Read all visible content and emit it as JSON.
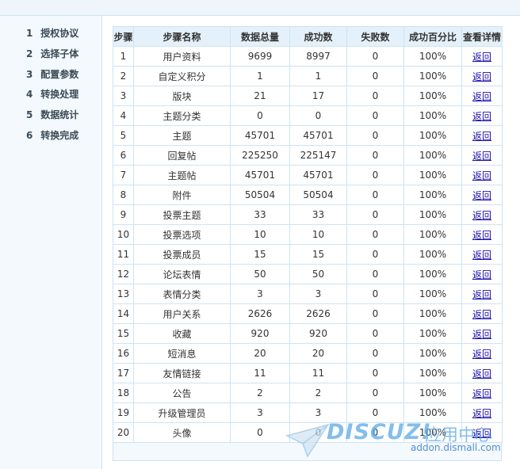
{
  "sidebar": {
    "steps": [
      {
        "num": "1",
        "label": "授权协议"
      },
      {
        "num": "2",
        "label": "选择子体"
      },
      {
        "num": "3",
        "label": "配置参数"
      },
      {
        "num": "4",
        "label": "转换处理"
      },
      {
        "num": "5",
        "label": "数据统计"
      },
      {
        "num": "6",
        "label": "转换完成"
      }
    ]
  },
  "table": {
    "headers": [
      "步骤",
      "步骤名称",
      "数据总量",
      "成功数",
      "失败数",
      "成功百分比",
      "查看详情"
    ],
    "rows": [
      {
        "step": "1",
        "name": "用户资料",
        "total": "9699",
        "success": "8997",
        "fail": "0",
        "percent": "100%",
        "link": "返回"
      },
      {
        "step": "2",
        "name": "自定义积分",
        "total": "1",
        "success": "1",
        "fail": "0",
        "percent": "100%",
        "link": "返回"
      },
      {
        "step": "3",
        "name": "版块",
        "total": "21",
        "success": "17",
        "fail": "0",
        "percent": "100%",
        "link": "返回"
      },
      {
        "step": "4",
        "name": "主题分类",
        "total": "0",
        "success": "0",
        "fail": "0",
        "percent": "100%",
        "link": "返回"
      },
      {
        "step": "5",
        "name": "主题",
        "total": "45701",
        "success": "45701",
        "fail": "0",
        "percent": "100%",
        "link": "返回"
      },
      {
        "step": "6",
        "name": "回复帖",
        "total": "225250",
        "success": "225147",
        "fail": "0",
        "percent": "100%",
        "link": "返回"
      },
      {
        "step": "7",
        "name": "主题帖",
        "total": "45701",
        "success": "45701",
        "fail": "0",
        "percent": "100%",
        "link": "返回"
      },
      {
        "step": "8",
        "name": "附件",
        "total": "50504",
        "success": "50504",
        "fail": "0",
        "percent": "100%",
        "link": "返回"
      },
      {
        "step": "9",
        "name": "投票主题",
        "total": "33",
        "success": "33",
        "fail": "0",
        "percent": "100%",
        "link": "返回"
      },
      {
        "step": "10",
        "name": "投票选项",
        "total": "10",
        "success": "10",
        "fail": "0",
        "percent": "100%",
        "link": "返回"
      },
      {
        "step": "11",
        "name": "投票成员",
        "total": "15",
        "success": "15",
        "fail": "0",
        "percent": "100%",
        "link": "返回"
      },
      {
        "step": "12",
        "name": "论坛表情",
        "total": "50",
        "success": "50",
        "fail": "0",
        "percent": "100%",
        "link": "返回"
      },
      {
        "step": "13",
        "name": "表情分类",
        "total": "3",
        "success": "3",
        "fail": "0",
        "percent": "100%",
        "link": "返回"
      },
      {
        "step": "14",
        "name": "用户关系",
        "total": "2626",
        "success": "2626",
        "fail": "0",
        "percent": "100%",
        "link": "返回"
      },
      {
        "step": "15",
        "name": "收藏",
        "total": "920",
        "success": "920",
        "fail": "0",
        "percent": "100%",
        "link": "返回"
      },
      {
        "step": "16",
        "name": "短消息",
        "total": "20",
        "success": "20",
        "fail": "0",
        "percent": "100%",
        "link": "返回"
      },
      {
        "step": "17",
        "name": "友情链接",
        "total": "11",
        "success": "11",
        "fail": "0",
        "percent": "100%",
        "link": "返回"
      },
      {
        "step": "18",
        "name": "公告",
        "total": "2",
        "success": "2",
        "fail": "0",
        "percent": "100%",
        "link": "返回"
      },
      {
        "step": "19",
        "name": "升级管理员",
        "total": "3",
        "success": "3",
        "fail": "0",
        "percent": "100%",
        "link": "返回"
      },
      {
        "step": "20",
        "name": "头像",
        "total": "0",
        "success": "0",
        "fail": "0",
        "percent": "100%",
        "link": "返回"
      }
    ]
  },
  "watermark": {
    "brand": "DISCUZ!",
    "cn": "应用中心",
    "url": "addon.dismall.com"
  },
  "colors": {
    "header_bg": "#e4f1fa",
    "border": "#cfe3f2",
    "sidebar_bg": "#f3f9fd",
    "link": "#1a0dab",
    "watermark": "#5aa9e6"
  }
}
